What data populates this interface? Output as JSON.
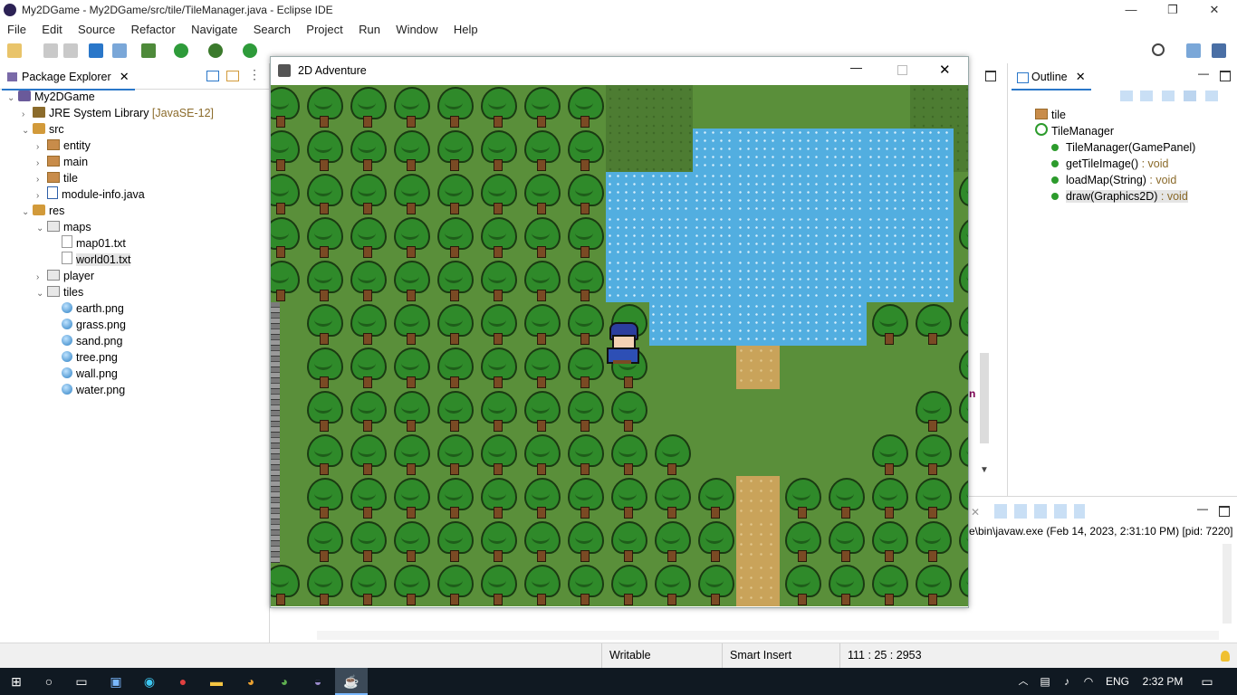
{
  "window": {
    "title": "My2DGame - My2DGame/src/tile/TileManager.java - Eclipse IDE",
    "min": "—",
    "max": "❐",
    "close": "✕"
  },
  "menu": [
    "File",
    "Edit",
    "Source",
    "Refactor",
    "Navigate",
    "Search",
    "Project",
    "Run",
    "Window",
    "Help"
  ],
  "package_explorer": {
    "tab": "Package Explorer",
    "tree": [
      {
        "label": "My2DGame",
        "indent": 0,
        "twisty": "v",
        "icon": "proj"
      },
      {
        "label": "JRE System Library",
        "extra": "[JavaSE-12]",
        "indent": 1,
        "twisty": ">",
        "icon": "lib"
      },
      {
        "label": "src",
        "indent": 1,
        "twisty": "v",
        "icon": "pkgfolder"
      },
      {
        "label": "entity",
        "indent": 2,
        "twisty": ">",
        "icon": "pkg"
      },
      {
        "label": "main",
        "indent": 2,
        "twisty": ">",
        "icon": "pkg"
      },
      {
        "label": "tile",
        "indent": 2,
        "twisty": ">",
        "icon": "pkg"
      },
      {
        "label": "module-info.java",
        "indent": 2,
        "twisty": ">",
        "icon": "java"
      },
      {
        "label": "res",
        "indent": 1,
        "twisty": "v",
        "icon": "pkgfolder"
      },
      {
        "label": "maps",
        "indent": 2,
        "twisty": "v",
        "icon": "folder"
      },
      {
        "label": "map01.txt",
        "indent": 3,
        "twisty": "",
        "icon": "file"
      },
      {
        "label": "world01.txt",
        "indent": 3,
        "twisty": "",
        "icon": "file",
        "selected": true
      },
      {
        "label": "player",
        "indent": 2,
        "twisty": ">",
        "icon": "folder"
      },
      {
        "label": "tiles",
        "indent": 2,
        "twisty": "v",
        "icon": "folder"
      },
      {
        "label": "earth.png",
        "indent": 3,
        "twisty": "",
        "icon": "png"
      },
      {
        "label": "grass.png",
        "indent": 3,
        "twisty": "",
        "icon": "png"
      },
      {
        "label": "sand.png",
        "indent": 3,
        "twisty": "",
        "icon": "png"
      },
      {
        "label": "tree.png",
        "indent": 3,
        "twisty": "",
        "icon": "png"
      },
      {
        "label": "wall.png",
        "indent": 3,
        "twisty": "",
        "icon": "png"
      },
      {
        "label": "water.png",
        "indent": 3,
        "twisty": "",
        "icon": "png"
      }
    ]
  },
  "outline": {
    "tab": "Outline",
    "items": [
      {
        "label": "tile",
        "ret": "",
        "indent": 0,
        "kind": "pkg"
      },
      {
        "label": "TileManager",
        "ret": "",
        "indent": 0,
        "kind": "class"
      },
      {
        "label": "TileManager(GamePanel)",
        "ret": "",
        "indent": 1,
        "kind": "ctor"
      },
      {
        "label": "getTileImage()",
        "ret": " : void",
        "indent": 1,
        "kind": "method"
      },
      {
        "label": "loadMap(String)",
        "ret": " : void",
        "indent": 1,
        "kind": "method"
      },
      {
        "label": "draw(Graphics2D)",
        "ret": " : void",
        "indent": 1,
        "kind": "method",
        "selected": true
      }
    ]
  },
  "console": {
    "line": "re\\bin\\javaw.exe  (Feb 14, 2023, 2:31:10 PM) [pid: 7220]"
  },
  "editor_peek": {
    "char": "n"
  },
  "status": {
    "writable": "Writable",
    "insert": "Smart Insert",
    "position": "111 : 25 : 2953"
  },
  "game": {
    "title": "2D Adventure",
    "map": [
      "TTTTTTTTEEGGGGGEET",
      "TTTTTTTTEEWWWWWWEE",
      "TTTTTTTTWWWWWWWWTT",
      "TTTTTTTTWWWWWWWWTT",
      "TTTTTTTTWWWWWWWWTT",
      "LTTTTTTTTWWWWWTTTT",
      "LTTTTTTTTGGSGGGGTT",
      "LTTTTTTTTGGGGGGTTT",
      "LTTTTTTTTTGGGGTTTT",
      "LTTTTTTTTTTSTTTTTT",
      "LTTTTTTTTTTSTTTTTT",
      "TTTTTTTTTTTSTTTTTT"
    ]
  },
  "taskbar": {
    "lang": "ENG",
    "time": "2:32 PM"
  },
  "colors": {
    "accent": "#2a77c9",
    "grass": "#5a8f3a",
    "water": "#52aee0",
    "sand": "#c9a35a"
  }
}
